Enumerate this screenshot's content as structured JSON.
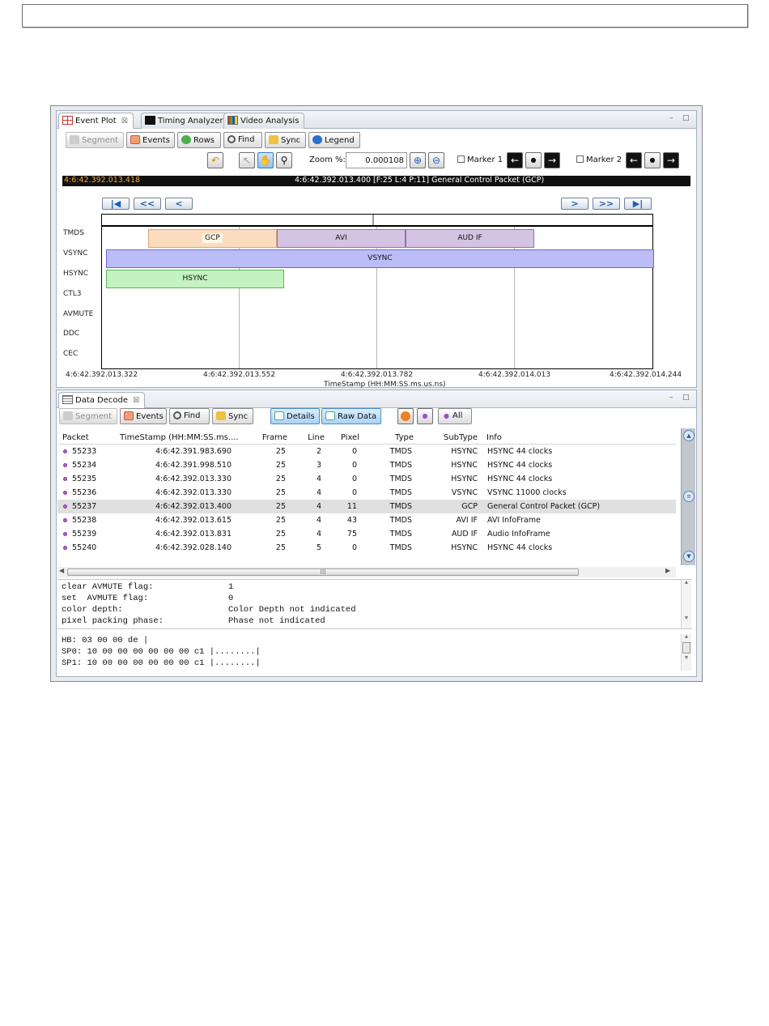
{
  "event_plot": {
    "tabs": [
      {
        "label": "Event Plot",
        "close": "☒"
      },
      {
        "label": "Timing Analyzer"
      },
      {
        "label": "Video Analysis"
      }
    ],
    "window_controls": {
      "minimize": "–",
      "maximize": "□"
    },
    "toolbar": {
      "segment": "Segment",
      "events": "Events",
      "rows": "Rows",
      "find": "Find",
      "sync": "Sync",
      "legend": "Legend"
    },
    "zoom": {
      "label": "Zoom %:",
      "value": "0.000108"
    },
    "marker1": {
      "label": "Marker 1",
      "checked": false
    },
    "marker2": {
      "label": "Marker 2",
      "checked": false
    },
    "status": {
      "cursor_time": "4:6:42.392.013.418",
      "packet_info": "4:6:42.392.013.400 [F:25 L:4 P:11] General Control Packet (GCP)"
    },
    "rows": [
      "TMDS",
      "VSYNC",
      "HSYNC",
      "CTL3",
      "AVMUTE",
      "DDC",
      "CEC"
    ],
    "segments": {
      "gcp": "GCP",
      "avi": "AVI",
      "aud_if": "AUD IF",
      "vsync": "VSYNC",
      "hsync": "HSYNC"
    },
    "axis": {
      "ticks": [
        "4:6:42.392.013.322",
        "4:6:42.392.013.552",
        "4:6:42.392.013.782",
        "4:6:42.392.014.013",
        "4:6:42.392.014.244"
      ],
      "title": "TimeStamp (HH:MM:SS.ms.us.ns)"
    }
  },
  "data_decode": {
    "tab": {
      "label": "Data Decode",
      "close": "☒"
    },
    "toolbar": {
      "segment": "Segment",
      "events": "Events",
      "find": "Find",
      "sync": "Sync",
      "details": "Details",
      "raw_data": "Raw Data",
      "all": "All"
    },
    "columns": [
      "Packet",
      "TimeStamp (HH:MM:SS.ms....",
      "Frame",
      "Line",
      "Pixel",
      "Type",
      "SubType",
      "Info"
    ],
    "rows": [
      {
        "packet": "55233",
        "timestamp": "4:6:42.391.983.690",
        "frame": "25",
        "line": "2",
        "pixel": "0",
        "type": "TMDS",
        "subtype": "HSYNC",
        "info": "HSYNC 44 clocks"
      },
      {
        "packet": "55234",
        "timestamp": "4:6:42.391.998.510",
        "frame": "25",
        "line": "3",
        "pixel": "0",
        "type": "TMDS",
        "subtype": "HSYNC",
        "info": "HSYNC 44 clocks"
      },
      {
        "packet": "55235",
        "timestamp": "4:6:42.392.013.330",
        "frame": "25",
        "line": "4",
        "pixel": "0",
        "type": "TMDS",
        "subtype": "HSYNC",
        "info": "HSYNC 44 clocks"
      },
      {
        "packet": "55236",
        "timestamp": "4:6:42.392.013.330",
        "frame": "25",
        "line": "4",
        "pixel": "0",
        "type": "TMDS",
        "subtype": "VSYNC",
        "info": "VSYNC 11000 clocks"
      },
      {
        "packet": "55237",
        "timestamp": "4:6:42.392.013.400",
        "frame": "25",
        "line": "4",
        "pixel": "11",
        "type": "TMDS",
        "subtype": "GCP",
        "info": "General Control Packet (GCP)"
      },
      {
        "packet": "55238",
        "timestamp": "4:6:42.392.013.615",
        "frame": "25",
        "line": "4",
        "pixel": "43",
        "type": "TMDS",
        "subtype": "AVI IF",
        "info": "AVI InfoFrame"
      },
      {
        "packet": "55239",
        "timestamp": "4:6:42.392.013.831",
        "frame": "25",
        "line": "4",
        "pixel": "75",
        "type": "TMDS",
        "subtype": "AUD IF",
        "info": "Audio InfoFrame"
      },
      {
        "packet": "55240",
        "timestamp": "4:6:42.392.028.140",
        "frame": "25",
        "line": "5",
        "pixel": "0",
        "type": "TMDS",
        "subtype": "HSYNC",
        "info": "HSYNC 44 clocks"
      }
    ],
    "selected_packet": "55237",
    "details": [
      {
        "name": "clear AVMUTE flag:",
        "value": "1"
      },
      {
        "name": "set  AVMUTE flag:",
        "value": "0"
      },
      {
        "name": "color depth:",
        "value": "Color Depth not indicated"
      },
      {
        "name": "pixel packing phase:",
        "value": "Phase not indicated"
      }
    ],
    "raw": [
      "HB: 03 00 00 de |",
      "SP0: 10 00 00 00 00 00 00 c1 |........|",
      "SP1: 10 00 00 00 00 00 00 c1 |........|"
    ],
    "scroll_thumb": "III"
  }
}
